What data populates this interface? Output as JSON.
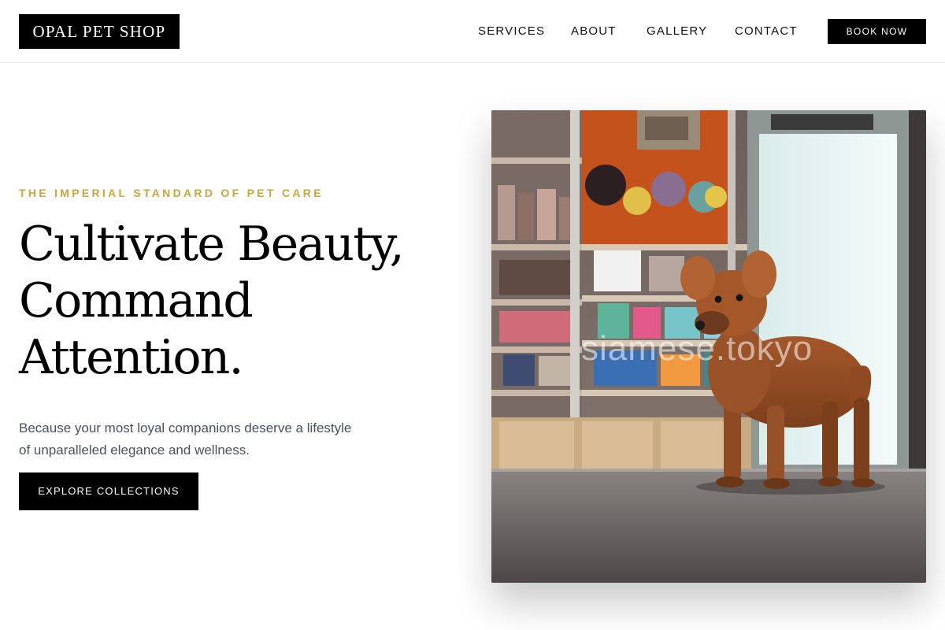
{
  "brand": {
    "name": "OPAL PET SHOP"
  },
  "nav": {
    "items": [
      "SERVICES",
      "ABOUT",
      "GALLERY",
      "CONTACT"
    ],
    "cta_label": "BOOK NOW"
  },
  "hero": {
    "eyebrow": "THE IMPERIAL STANDARD OF PET CARE",
    "headline_lines": [
      "Cultivate Beauty,",
      "Command",
      "Attention."
    ],
    "subtext": "Because your most loyal companions deserve a lifestyle of unparalleled elegance and wellness.",
    "button_label": "EXPLORE COLLECTIONS",
    "image_watermark": "siamese.tokyo"
  },
  "colors": {
    "accent_gold": "#c9a53a",
    "primary_black": "#000000",
    "subtext_gray": "#4a5060"
  }
}
